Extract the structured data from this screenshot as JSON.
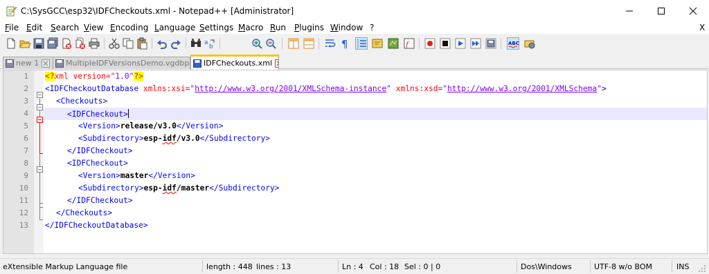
{
  "window": {
    "title": "C:\\SysGCC\\esp32\\IDFCheckouts.xml - Notepad++ [Administrator]"
  },
  "menu": {
    "items": [
      "File",
      "Edit",
      "Search",
      "View",
      "Encoding",
      "Language",
      "Settings",
      "Macro",
      "Run",
      "Plugins",
      "Window",
      "?"
    ],
    "close_x": "X"
  },
  "tabs": [
    {
      "label": "new 1",
      "active": false,
      "icon": "save-disk-icon"
    },
    {
      "label": "MultipleIDFVersionsDemo.vgdbproj",
      "active": false,
      "icon": "save-disk-icon"
    },
    {
      "label": "IDFCheckouts.xml",
      "active": true,
      "icon": "save-disk-icon"
    }
  ],
  "editor": {
    "current_line": 4,
    "lines": [
      {
        "n": "1"
      },
      {
        "n": "2"
      },
      {
        "n": "3"
      },
      {
        "n": "4"
      },
      {
        "n": "5"
      },
      {
        "n": "6"
      },
      {
        "n": "7"
      },
      {
        "n": "8"
      },
      {
        "n": "9"
      },
      {
        "n": "10"
      },
      {
        "n": "11"
      },
      {
        "n": "12"
      },
      {
        "n": "13"
      }
    ],
    "text": {
      "pi_open": "<?",
      "pi_name": "xml",
      "pi_attr": " version=",
      "pi_val": "\"1.0\"",
      "pi_close": "?>",
      "root_open": "<IDFCheckoutDatabase",
      "attr_xsi": " xmlns:xsi=",
      "q": "\"",
      "url_xsi": "http://www.w3.org/2001/XMLSchema-instance",
      "attr_xsd": " xmlns:xsd=",
      "url_xsd": "http://www.w3.org/2001/XMLSchema",
      "gt": ">",
      "checkouts_open": "<Checkouts>",
      "checkout_open": "<IDFCheckout>",
      "version_open": "<Version>",
      "version_close": "</Version>",
      "subdir_open": "<Subdirectory>",
      "subdir_close": "</Subdirectory>",
      "checkout_close": "</IDFCheckout>",
      "checkouts_close": "</Checkouts>",
      "root_close": "</IDFCheckoutDatabase>",
      "v1_version": "release/v3.0",
      "v1_sub_a": "esp-",
      "v1_sub_b": "idf",
      "v1_sub_c": "/v3.0",
      "v2_version": "master",
      "v2_sub_a": "esp-",
      "v2_sub_b": "idf",
      "v2_sub_c": "/master"
    }
  },
  "status": {
    "file_type": "eXtensible Markup Language file",
    "length": "length : 448",
    "lines": "lines : 13",
    "ln": "Ln : 4",
    "col": "Col : 18",
    "sel": "Sel : 0 | 0",
    "eol": "Dos\\Windows",
    "encoding": "UTF-8 w/o BOM",
    "mode": "INS"
  },
  "colors": {
    "tag": "#0000ff",
    "attribute": "#ff0000",
    "value": "#8000ff",
    "current_line": "#e8e8ff",
    "active_tab_accent": "#fac31f"
  }
}
